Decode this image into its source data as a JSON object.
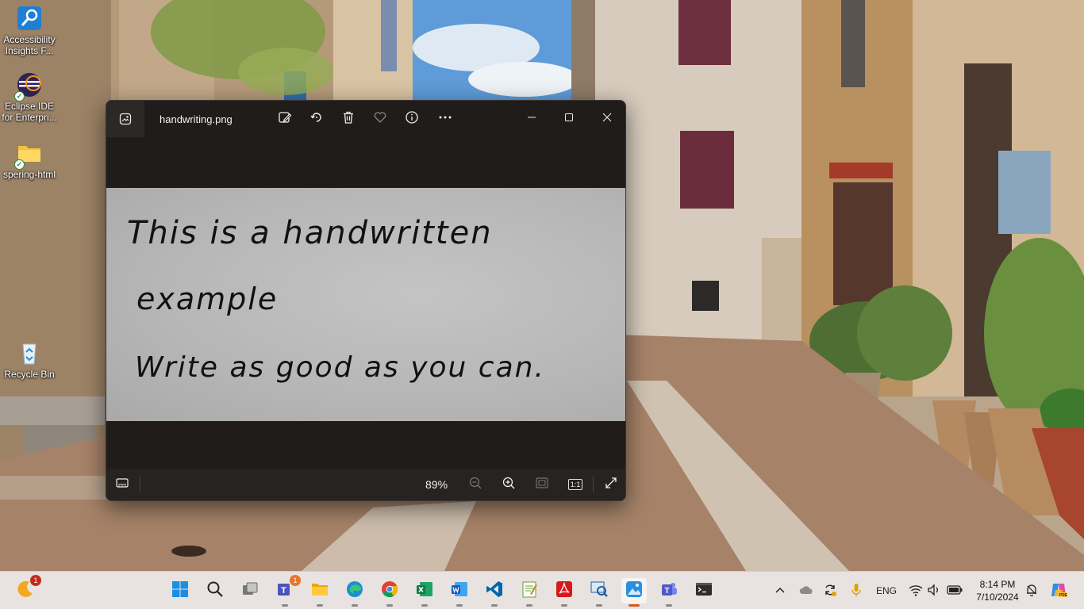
{
  "desktop": {
    "icons": [
      {
        "label": "Accessibility Insights F...",
        "icon": "accessibility-insights-icon"
      },
      {
        "label": "Eclipse IDE for Enterpri...",
        "icon": "eclipse-icon"
      },
      {
        "label": "spering-html",
        "icon": "folder-icon"
      },
      {
        "label": "Recycle Bin",
        "icon": "recycle-bin-icon"
      }
    ]
  },
  "photos_window": {
    "title": "handwriting.png",
    "toolbar": [
      "edit-image-icon",
      "rotate-icon",
      "delete-icon",
      "favorite-icon",
      "info-icon",
      "more-icon"
    ],
    "window_controls": [
      "minimize-icon",
      "maximize-icon",
      "close-icon"
    ],
    "image_lines": [
      "This is a handwritten",
      "example",
      "Write as good as you can."
    ],
    "zoom": "89%",
    "bottom_controls": [
      "filmstrip-icon",
      "zoom-out-icon",
      "zoom-in-icon",
      "fit-to-window-icon",
      "actual-size-icon",
      "fullscreen-icon"
    ],
    "actual_size_label": "1:1"
  },
  "taskbar": {
    "widget_badge": "1",
    "apps": [
      {
        "name": "start",
        "icon": "windows-start-icon"
      },
      {
        "name": "search",
        "icon": "search-icon"
      },
      {
        "name": "task-view",
        "icon": "task-view-icon"
      },
      {
        "name": "teams-classic",
        "icon": "teams-icon",
        "badge": "1"
      },
      {
        "name": "file-explorer",
        "icon": "folder-icon"
      },
      {
        "name": "edge",
        "icon": "edge-icon"
      },
      {
        "name": "chrome",
        "icon": "chrome-icon"
      },
      {
        "name": "excel",
        "icon": "excel-icon"
      },
      {
        "name": "word",
        "icon": "word-icon"
      },
      {
        "name": "vscode",
        "icon": "vscode-icon"
      },
      {
        "name": "notepad-plus",
        "icon": "notepad-plus-icon"
      },
      {
        "name": "acrobat",
        "icon": "acrobat-icon"
      },
      {
        "name": "accessibility-insights",
        "icon": "accessibility-insights-icon"
      },
      {
        "name": "photos",
        "icon": "photos-icon"
      },
      {
        "name": "teams",
        "icon": "teams-new-icon"
      },
      {
        "name": "terminal",
        "icon": "terminal-icon"
      }
    ],
    "tray": {
      "language": "ENG",
      "time": "8:14 PM",
      "date": "7/10/2024"
    }
  },
  "colors": {
    "accent": "#d45a1e",
    "window_bg": "#1f1c1a",
    "taskbar_bg": "#e8e3e0"
  }
}
